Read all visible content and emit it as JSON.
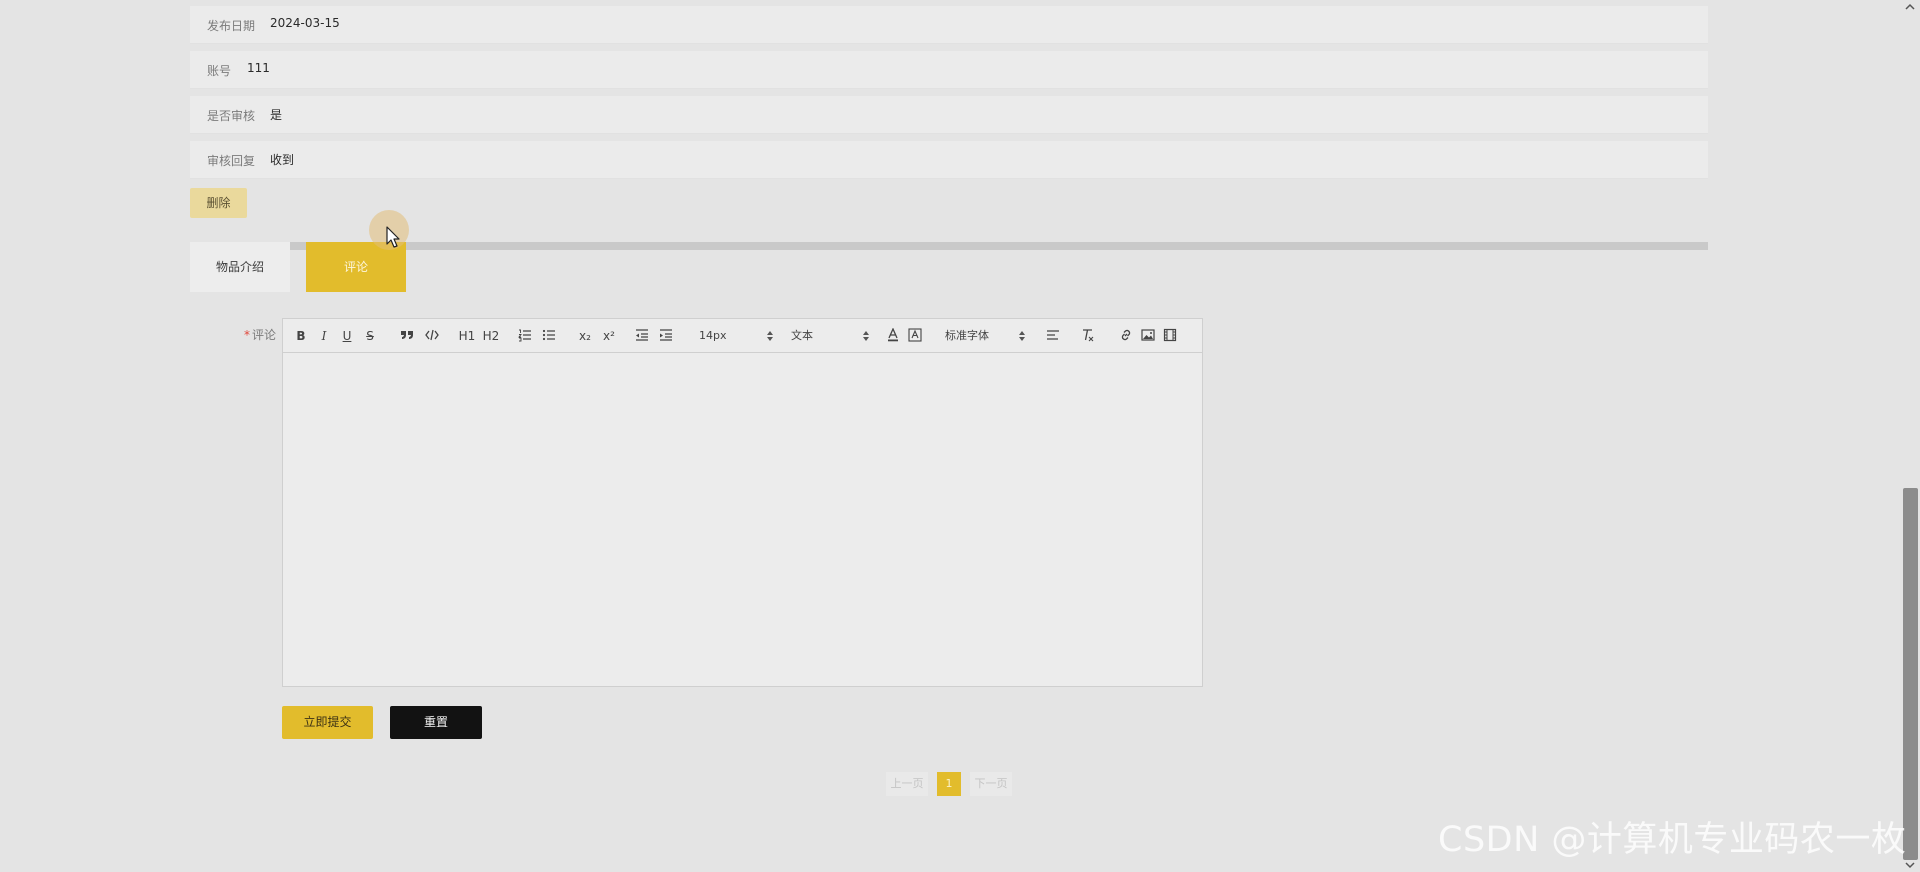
{
  "details": {
    "publish_date": {
      "label": "发布日期",
      "value": "2024-03-15"
    },
    "account": {
      "label": "账号",
      "value": "111"
    },
    "approved": {
      "label": "是否审核",
      "value": "是"
    },
    "review_reply": {
      "label": "审核回复",
      "value": "收到"
    }
  },
  "actions": {
    "delete_label": "删除"
  },
  "tabs": [
    {
      "label": "物品介绍",
      "active": false
    },
    {
      "label": "评论",
      "active": true
    }
  ],
  "comment_form": {
    "required_mark": "*",
    "label": "评论",
    "toolbar": {
      "bold": "B",
      "italic": "I",
      "underline": "U",
      "strike": "S",
      "h1": "H1",
      "h2": "H2",
      "subscript": "x₂",
      "superscript": "x²",
      "font_size": "14px",
      "header_format": "文本",
      "font_family": "标准字体"
    },
    "submit_label": "立即提交",
    "reset_label": "重置"
  },
  "pagination": {
    "prev_label": "上一页",
    "current_page": "1",
    "next_label": "下一页"
  },
  "watermark": "CSDN @计算机专业码农一枚",
  "colors": {
    "accent": "#e2bc2c",
    "delete_button": "#ead99c",
    "reset_button": "#121212",
    "background": "#e4e4e4",
    "required": "#e0473b"
  }
}
